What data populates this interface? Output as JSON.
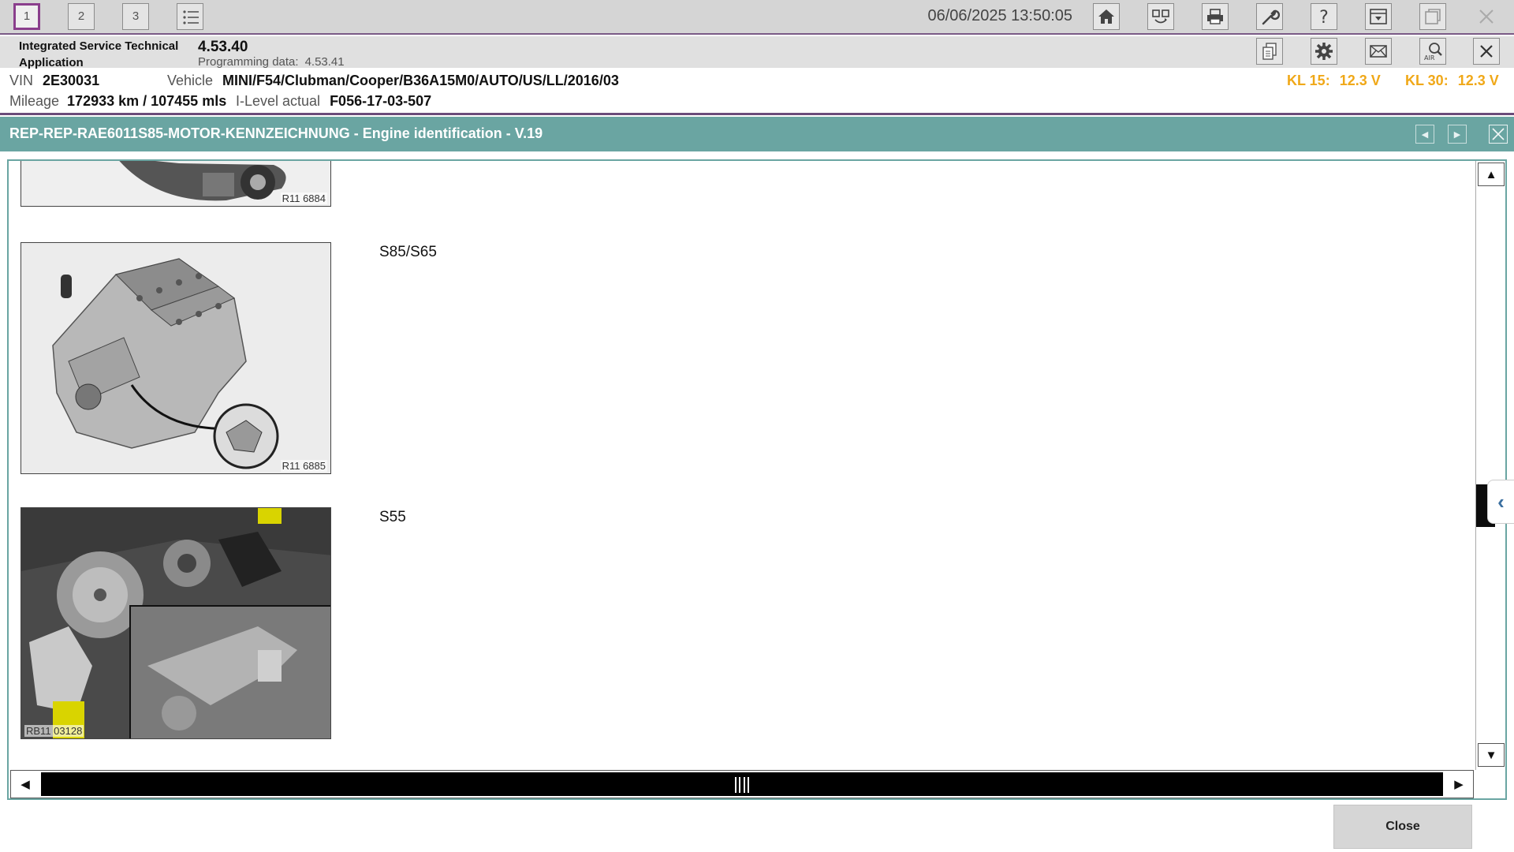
{
  "top_bar": {
    "tabs": [
      "1",
      "2",
      "3"
    ],
    "active_tab": "1",
    "datetime": "06/06/2025 13:50:05",
    "icons": [
      "home-icon",
      "vehicle-swap-icon",
      "print-icon",
      "wrench-icon",
      "help-icon",
      "dropdown-panel-icon",
      "window-restore-icon",
      "close-icon"
    ]
  },
  "app_bar": {
    "app_name_line1": "Integrated Service Technical",
    "app_name_line2": "Application",
    "version": "4.53.40",
    "programming_label": "Programming data:",
    "programming_value": "4.53.41",
    "icons": [
      "documents-icon",
      "gear-icon",
      "mail-icon",
      "air-search-icon",
      "close-icon"
    ]
  },
  "vehicle": {
    "vin_label": "VIN",
    "vin": "2E30031",
    "vehicle_label": "Vehicle",
    "vehicle": "MINI/F54/Clubman/Cooper/B36A15M0/AUTO/US/LL/2016/03",
    "mileage_label": "Mileage",
    "mileage": "172933 km / 107455 mls",
    "ilevel_label": "I-Level actual",
    "ilevel": "F056-17-03-507",
    "kl15_label": "KL 15:",
    "kl15_value": "12.3 V",
    "kl30_label": "KL 30:",
    "kl30_value": "12.3 V"
  },
  "document": {
    "title": "REP-REP-RAE6011S85-MOTOR-KENNZEICHNUNG - Engine identification - V.19",
    "figures": [
      {
        "code": "R11 6884",
        "label": ""
      },
      {
        "code": "R11 6885",
        "label": "S85/S65"
      },
      {
        "code": "RB11 03128",
        "label": "S55"
      }
    ]
  },
  "footer": {
    "close_label": "Close"
  },
  "colors": {
    "accent_purple": "#8a3e8c",
    "title_bar_teal": "#6aa5a2",
    "voltage_orange": "#f0a818"
  }
}
